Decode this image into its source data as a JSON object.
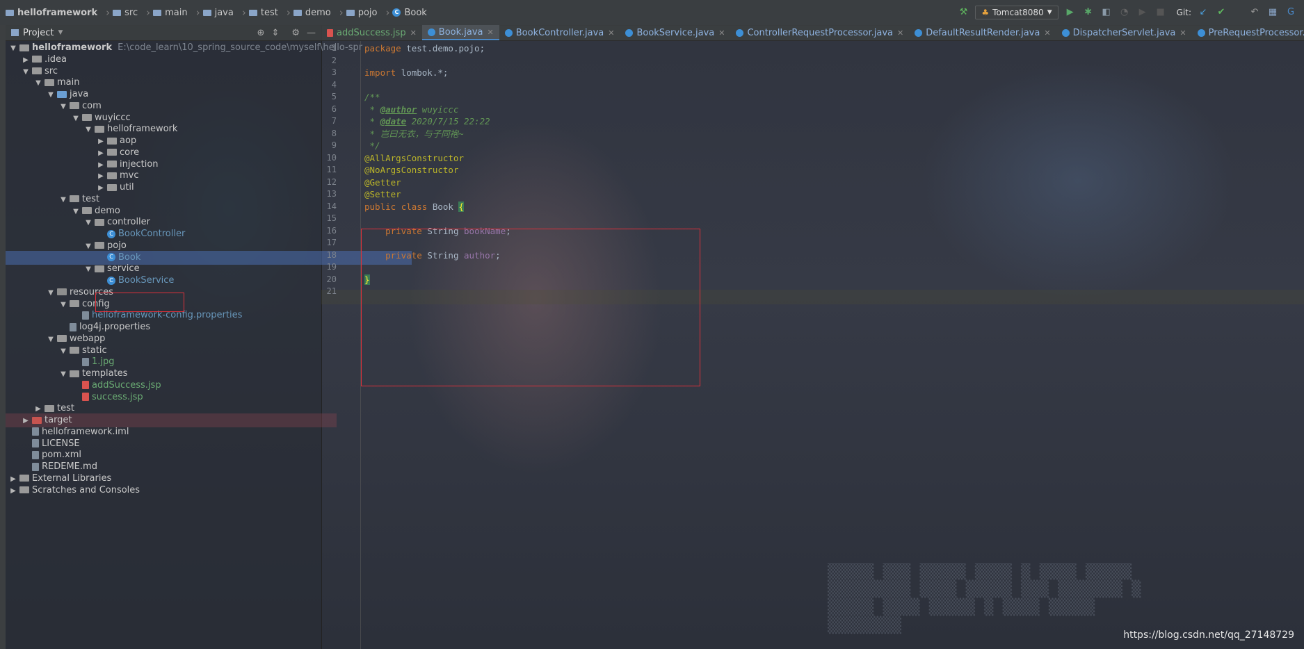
{
  "breadcrumb": [
    "helloframework",
    "src",
    "main",
    "java",
    "test",
    "demo",
    "pojo",
    "Book"
  ],
  "toolbar": {
    "run_config": "Tomcat8080",
    "git_label": "Git:"
  },
  "project_panel": {
    "title": "Project",
    "root_name": "helloframework",
    "root_path": "E:\\code_learn\\10_spring_source_code\\myself\\hello-spr",
    "items": [
      {
        "label": "helloframework",
        "depth": 0,
        "arrow": "▼",
        "icon": "folder"
      },
      {
        "label": ".idea",
        "depth": 1,
        "arrow": "▶",
        "icon": "folder"
      },
      {
        "label": "src",
        "depth": 1,
        "arrow": "▼",
        "icon": "folder"
      },
      {
        "label": "main",
        "depth": 2,
        "arrow": "▼",
        "icon": "folder"
      },
      {
        "label": "java",
        "depth": 3,
        "arrow": "▼",
        "icon": "src"
      },
      {
        "label": "com",
        "depth": 4,
        "arrow": "▼",
        "icon": "folder"
      },
      {
        "label": "wuyiccc",
        "depth": 5,
        "arrow": "▼",
        "icon": "folder"
      },
      {
        "label": "helloframework",
        "depth": 6,
        "arrow": "▼",
        "icon": "folder"
      },
      {
        "label": "aop",
        "depth": 7,
        "arrow": "▶",
        "icon": "folder"
      },
      {
        "label": "core",
        "depth": 7,
        "arrow": "▶",
        "icon": "folder"
      },
      {
        "label": "injection",
        "depth": 7,
        "arrow": "▶",
        "icon": "folder"
      },
      {
        "label": "mvc",
        "depth": 7,
        "arrow": "▶",
        "icon": "folder"
      },
      {
        "label": "util",
        "depth": 7,
        "arrow": "▶",
        "icon": "folder"
      },
      {
        "label": "test",
        "depth": 4,
        "arrow": "▼",
        "icon": "folder"
      },
      {
        "label": "demo",
        "depth": 5,
        "arrow": "▼",
        "icon": "folder"
      },
      {
        "label": "controller",
        "depth": 6,
        "arrow": "▼",
        "icon": "folder"
      },
      {
        "label": "BookController",
        "depth": 7,
        "arrow": "",
        "icon": "class"
      },
      {
        "label": "pojo",
        "depth": 6,
        "arrow": "▼",
        "icon": "folder"
      },
      {
        "label": "Book",
        "depth": 7,
        "arrow": "",
        "icon": "class",
        "selected": true
      },
      {
        "label": "service",
        "depth": 6,
        "arrow": "▼",
        "icon": "folder"
      },
      {
        "label": "BookService",
        "depth": 7,
        "arrow": "",
        "icon": "class"
      },
      {
        "label": "resources",
        "depth": 3,
        "arrow": "▼",
        "icon": "res"
      },
      {
        "label": "config",
        "depth": 4,
        "arrow": "▼",
        "icon": "folder"
      },
      {
        "label": "helloframework-config.properties",
        "depth": 5,
        "arrow": "",
        "icon": "file",
        "color": "blue"
      },
      {
        "label": "log4j.properties",
        "depth": 4,
        "arrow": "",
        "icon": "file"
      },
      {
        "label": "webapp",
        "depth": 3,
        "arrow": "▼",
        "icon": "folder"
      },
      {
        "label": "static",
        "depth": 4,
        "arrow": "▼",
        "icon": "folder"
      },
      {
        "label": "1.jpg",
        "depth": 5,
        "arrow": "",
        "icon": "file",
        "color": "green"
      },
      {
        "label": "templates",
        "depth": 4,
        "arrow": "▼",
        "icon": "folder"
      },
      {
        "label": "addSuccess.jsp",
        "depth": 5,
        "arrow": "",
        "icon": "jsp",
        "color": "green"
      },
      {
        "label": "success.jsp",
        "depth": 5,
        "arrow": "",
        "icon": "jsp",
        "color": "green"
      },
      {
        "label": "test",
        "depth": 2,
        "arrow": "▶",
        "icon": "folder"
      },
      {
        "label": "target",
        "depth": 1,
        "arrow": "▶",
        "icon": "red",
        "excluded": true
      },
      {
        "label": "helloframework.iml",
        "depth": 1,
        "arrow": "",
        "icon": "file"
      },
      {
        "label": "LICENSE",
        "depth": 1,
        "arrow": "",
        "icon": "file"
      },
      {
        "label": "pom.xml",
        "depth": 1,
        "arrow": "",
        "icon": "file"
      },
      {
        "label": "REDEME.md",
        "depth": 1,
        "arrow": "",
        "icon": "file"
      },
      {
        "label": "External Libraries",
        "depth": 0,
        "arrow": "▶",
        "icon": "lib"
      },
      {
        "label": "Scratches and Consoles",
        "depth": 0,
        "arrow": "▶",
        "icon": "lib"
      }
    ]
  },
  "tabs": [
    {
      "label": "addSuccess.jsp",
      "type": "jsp"
    },
    {
      "label": "Book.java",
      "type": "class",
      "active": true
    },
    {
      "label": "BookController.java",
      "type": "class"
    },
    {
      "label": "BookService.java",
      "type": "class"
    },
    {
      "label": "ControllerRequestProcessor.java",
      "type": "class"
    },
    {
      "label": "DefaultResultRender.java",
      "type": "class"
    },
    {
      "label": "DispatcherServlet.java",
      "type": "class"
    },
    {
      "label": "PreRequestProcessor.java",
      "type": "class"
    }
  ],
  "code_lines": [
    "package test.demo.pojo;",
    "",
    "import lombok.*;",
    "",
    "/**",
    " * @author wuyiccc",
    " * @date 2020/7/15 22:22",
    " * 岂曰无衣，与子同袍~",
    " */",
    "@AllArgsConstructor",
    "@NoArgsConstructor",
    "@Getter",
    "@Setter",
    "public class Book {",
    "",
    "    private String bookName;",
    "",
    "    private String author;",
    "",
    "}",
    ""
  ],
  "current_line": 18,
  "watermark": "https://blog.csdn.net/qq_27148729",
  "colors": {
    "highlight_box": "#e0303a",
    "keyword": "#cc7832",
    "annotation": "#bbb529",
    "comment": "#629755",
    "field": "#9876aa"
  }
}
